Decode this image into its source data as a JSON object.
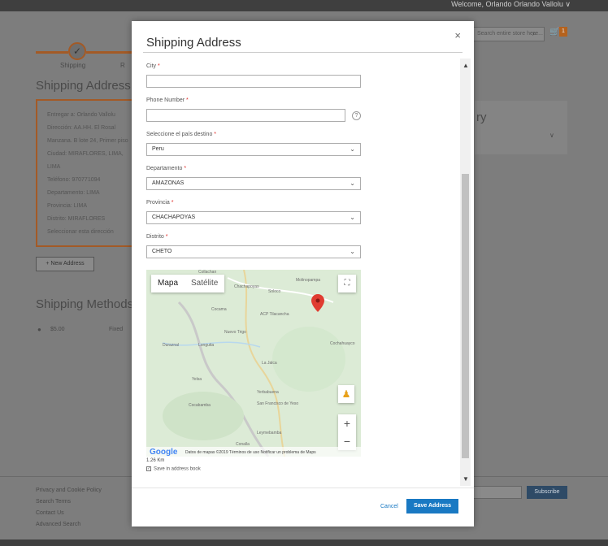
{
  "header": {
    "welcome": "Welcome, Orlando  Orlando Vallolu ∨"
  },
  "background": {
    "search_placeholder": "Search entire store here...",
    "cart_count": "1",
    "step_shipping": "Shipping",
    "step_review": "R",
    "shipping_address_heading": "Shipping Address",
    "address_lines": [
      "Entregar a: Orlando Vallolu",
      "Dirección: AA.HH. El Rosal",
      "Manzana. B lote 24, Primer piso",
      "Ciudad: MIRAFLORES, LIMA,",
      "LIMA",
      "Teléfono: 970771094",
      "Departamento: LIMA",
      "Provincia: LIMA",
      "Distrito: MIRAFLORES",
      "Seleccionar esta dirección"
    ],
    "new_address": "+ New Address",
    "shipping_methods_heading": "Shipping Methods",
    "method_price": "$5.00",
    "method_name": "Fixed",
    "summary_heading": "ry",
    "footer_links": [
      "Privacy and Cookie Policy",
      "Search Terms",
      "Contact Us",
      "Advanced Search"
    ],
    "subscribe_label": "Subscribe"
  },
  "modal": {
    "title": "Shipping Address",
    "close": "×",
    "fields": {
      "city": {
        "label": "City",
        "value": ""
      },
      "phone": {
        "label": "Phone Number",
        "value": ""
      },
      "country": {
        "label": "Seleccione el país destino",
        "value": "Peru"
      },
      "department": {
        "label": "Departamento",
        "value": "AMAZONAS"
      },
      "province": {
        "label": "Provincia",
        "value": "CHACHAPOYAS"
      },
      "district": {
        "label": "Distrito",
        "value": "CHETO"
      }
    },
    "required_mark": "*",
    "help_icon": "?",
    "map": {
      "btn_map": "Mapa",
      "btn_satellite": "Satélite",
      "attribution": "Datos de mapas ©2019   Términos de uso   Notificar un problema de Maps",
      "google": "Google",
      "places": [
        "Collachan",
        "Chachapoyas",
        "Soloco",
        "Molinopampa",
        "Cocama",
        "ACP Tilacancha",
        "Nuevo Trigo",
        "Longuita",
        "Duraznal",
        "Cochahuayco",
        "La Jalca",
        "Yelsa",
        "Yerbabuena",
        "Cocabamba",
        "San Francisco de Yeso",
        "Leymebamba",
        "Conalla"
      ],
      "scale": "1.26 Km"
    },
    "save_in_book": "Save in address book",
    "cancel_label": "Cancel",
    "save_label": "Save Address"
  }
}
